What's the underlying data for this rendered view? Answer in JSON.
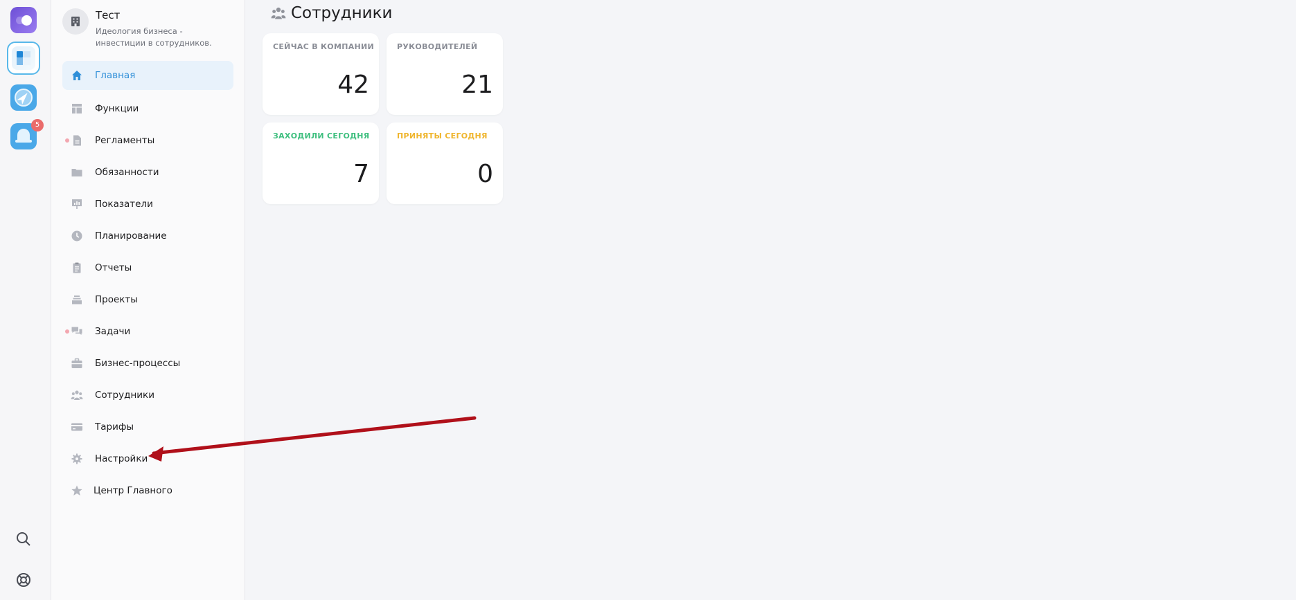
{
  "rail": {
    "notification_count": "5",
    "icons": [
      "toggle-icon",
      "workspace-icon",
      "compass-icon",
      "bell-icon",
      "search-icon",
      "help-icon"
    ]
  },
  "sidebar": {
    "org": {
      "name": "Тест",
      "description": "Идеология бизнеса - инвестиции в сотрудников."
    },
    "items": [
      {
        "label": "Главная",
        "icon": "home-icon",
        "active": true,
        "dot": false
      },
      {
        "label": "Функции",
        "icon": "layout-icon",
        "active": false,
        "dot": false
      },
      {
        "label": "Регламенты",
        "icon": "document-icon",
        "active": false,
        "dot": true
      },
      {
        "label": "Обязанности",
        "icon": "folder-icon",
        "active": false,
        "dot": false
      },
      {
        "label": "Показатели",
        "icon": "presentation-icon",
        "active": false,
        "dot": false
      },
      {
        "label": "Планирование",
        "icon": "clock-icon",
        "active": false,
        "dot": false
      },
      {
        "label": "Отчеты",
        "icon": "clipboard-icon",
        "active": false,
        "dot": false
      },
      {
        "label": "Проекты",
        "icon": "stack-icon",
        "active": false,
        "dot": false
      },
      {
        "label": "Задачи",
        "icon": "chat-icon",
        "active": false,
        "dot": true
      },
      {
        "label": "Бизнес-процессы",
        "icon": "briefcase-icon",
        "active": false,
        "dot": false
      },
      {
        "label": "Сотрудники",
        "icon": "users-icon",
        "active": false,
        "dot": false
      },
      {
        "label": "Тарифы",
        "icon": "card-icon",
        "active": false,
        "dot": false
      },
      {
        "label": "Настройки",
        "icon": "gear-icon",
        "active": false,
        "dot": false
      },
      {
        "label": "Центр Главного",
        "icon": "star-icon",
        "active": false,
        "dot": false
      }
    ]
  },
  "main": {
    "title": "Сотрудники",
    "cards": [
      {
        "title": "СЕЙЧАС В КОМПАНИИ",
        "value": "42",
        "color": "#8a8d96"
      },
      {
        "title": "РУКОВОДИТЕЛЕЙ",
        "value": "21",
        "color": "#8a8d96"
      },
      {
        "title": "ЗАХОДИЛИ СЕГОДНЯ",
        "value": "7",
        "color": "#3fbf7f"
      },
      {
        "title": "ПРИНЯТЫ СЕГОДНЯ",
        "value": "0",
        "color": "#efb52d"
      }
    ]
  },
  "colors": {
    "accent": "#2f8fd8",
    "arrow": "#b0101a"
  }
}
